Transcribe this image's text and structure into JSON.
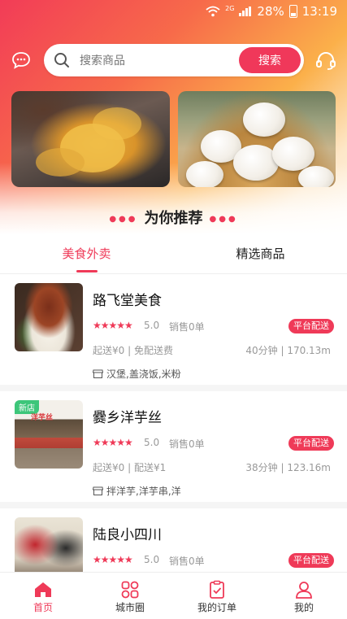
{
  "status_bar": {
    "signal_tag": "2G",
    "battery": "28%",
    "time": "13:19"
  },
  "search": {
    "placeholder": "搜索商品",
    "button_label": "搜索"
  },
  "recommend_title": "为你推荐",
  "tabs": [
    {
      "label": "美食外卖",
      "active": true
    },
    {
      "label": "精选商品",
      "active": false
    }
  ],
  "shops": [
    {
      "name": "路飞堂美食",
      "stars": "★★★★★",
      "rating": "5.0",
      "sales": "销售0单",
      "badge": "平台配送",
      "fee": "起送¥0 | 免配送费",
      "eta": "40分钟 | 170.13m",
      "tags": "汉堡,盖浇饭,米粉"
    },
    {
      "name": "爨乡洋芋丝",
      "new_label": "新店",
      "thumb_sign": "洋芋丝",
      "stars": "★★★★★",
      "rating": "5.0",
      "sales": "销售0单",
      "badge": "平台配送",
      "fee": "起送¥0 | 配送¥1",
      "eta": "38分钟 | 123.16m",
      "tags": "拌洋芋,洋芋串,洋"
    },
    {
      "name": "陆良小四川",
      "stars": "★★★★★",
      "rating": "5.0",
      "sales": "销售0单",
      "badge": "平台配送"
    }
  ],
  "bottom_nav": [
    {
      "label": "首页",
      "icon": "home-icon",
      "active": true
    },
    {
      "label": "城市圈",
      "icon": "city-circle-icon",
      "active": false
    },
    {
      "label": "我的订单",
      "icon": "orders-icon",
      "active": false
    },
    {
      "label": "我的",
      "icon": "profile-icon",
      "active": false
    }
  ],
  "colors": {
    "accent": "#ef3a58",
    "new_badge": "#3dc67a"
  }
}
